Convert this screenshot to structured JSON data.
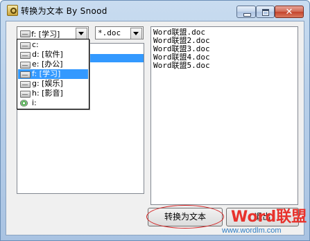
{
  "window": {
    "title": "转换为文本 By Snood",
    "controls": {
      "minimize_icon": "minimize-icon",
      "maximize_icon": "maximize-icon",
      "close_glyph": "✕"
    }
  },
  "drive_combo": {
    "value": "f: [学习]",
    "icon": "drive-icon"
  },
  "filter_combo": {
    "value": "*.doc"
  },
  "drive_dropdown": {
    "items": [
      {
        "label": "c:",
        "icon": "drive-icon",
        "selected": false
      },
      {
        "label": "d: [软件]",
        "icon": "drive-icon",
        "selected": false
      },
      {
        "label": "e: [办公]",
        "icon": "drive-icon",
        "selected": false
      },
      {
        "label": "f: [学习]",
        "icon": "drive-icon",
        "selected": true
      },
      {
        "label": "g: [娱乐]",
        "icon": "drive-icon",
        "selected": false
      },
      {
        "label": "h: [影音]",
        "icon": "drive-icon",
        "selected": false
      },
      {
        "label": "i:",
        "icon": "cd-drive-icon",
        "selected": false
      }
    ]
  },
  "file_list": {
    "items": [
      "Word联盟.doc",
      "Word联盟2.doc",
      "Word联盟3.doc",
      "Word联盟4.doc",
      "Word联盟5.doc"
    ]
  },
  "buttons": {
    "convert": "转换为文本",
    "exit": "退出"
  },
  "watermark": {
    "logo_part1": "Word",
    "logo_part2": "联盟",
    "url": "www.wordlm.com"
  },
  "colors": {
    "selection": "#3399ff",
    "highlight_ellipse": "#d42020",
    "watermark": "#e8322c",
    "url": "#2f7dc2"
  }
}
